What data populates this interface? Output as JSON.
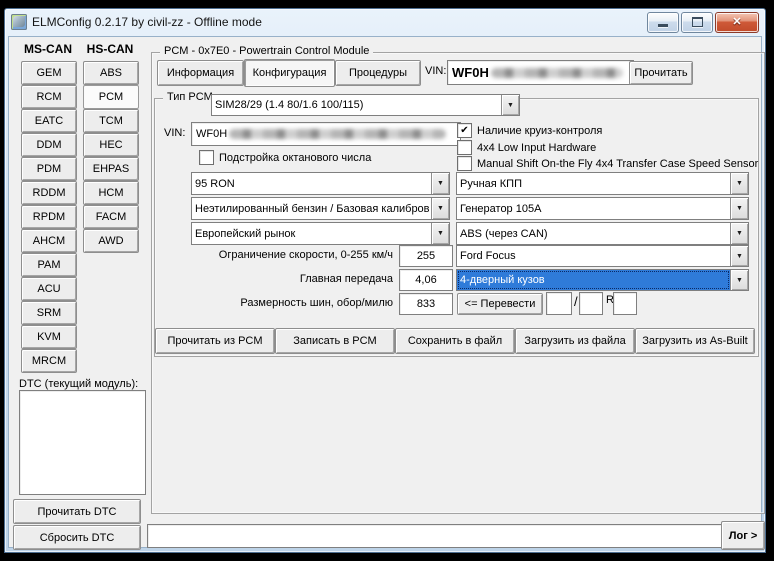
{
  "window": {
    "title": "ELMConfig 0.2.17 by civil-zz - Offline mode"
  },
  "sidebar": {
    "columns": [
      {
        "header": "MS-CAN",
        "buttons": [
          "GEM",
          "RCM",
          "EATC",
          "DDM",
          "PDM",
          "RDDM",
          "RPDM",
          "AHCM",
          "PAM",
          "ACU",
          "SRM",
          "KVM",
          "MRCM"
        ]
      },
      {
        "header": "HS-CAN",
        "buttons": [
          "ABS",
          "PCM",
          "TCM",
          "HEC",
          "EHPAS",
          "HCM",
          "FACM",
          "AWD"
        ],
        "active": "PCM"
      }
    ]
  },
  "dtc": {
    "label": "DTC (текущий модуль):",
    "read_button": "Прочитать DTC",
    "clear_button": "Сбросить DTC"
  },
  "main": {
    "group_title": "PCM - 0x7E0 - Powertrain Control Module",
    "tabs": [
      "Информация",
      "Конфигурация",
      "Процедуры"
    ],
    "active_tab": "Конфигурация",
    "vin_label": "VIN:",
    "vin_value": "WF0H",
    "read_button": "Прочитать"
  },
  "config": {
    "legend": "Тип PCM:",
    "pcm_type": "SIM28/29 (1.4 80/1.6 100/115)",
    "vin_label": "VIN:",
    "vin_value": "WF0H",
    "octane_label": "Подстройка октанового числа",
    "checkboxes": [
      {
        "label": "Наличие круиз-контроля",
        "check_glyph": "✔"
      },
      {
        "label": "4x4 Low Input Hardware",
        "check_glyph": ""
      },
      {
        "label": "Manual Shift On-the Fly 4x4 Transfer Case Speed Sensor",
        "check_glyph": ""
      }
    ],
    "combos_left": [
      "95 RON",
      "Неэтилированный бензин / Базовая калибров",
      "Европейский рынок"
    ],
    "combos_right": [
      "Ручная КПП",
      "Генератор 105A",
      "ABS (через CAN)"
    ],
    "rows": [
      {
        "label": "Ограничение скорости, 0-255 км/ч",
        "value": "255"
      },
      {
        "label": "Главная передача",
        "value": "4,06"
      },
      {
        "label": "Размерность шин, обор/милю",
        "value": "833"
      }
    ],
    "vehicle_combo": "Ford Focus",
    "body_combo": "4-дверный кузов",
    "convert_button": "<= Перевести",
    "slash": "/",
    "r_label": "R"
  },
  "actions": [
    "Прочитать из PCM",
    "Записать в PCM",
    "Сохранить в файл",
    "Загрузить из файла",
    "Загрузить из As-Built"
  ],
  "log": {
    "button": "Лог >"
  }
}
